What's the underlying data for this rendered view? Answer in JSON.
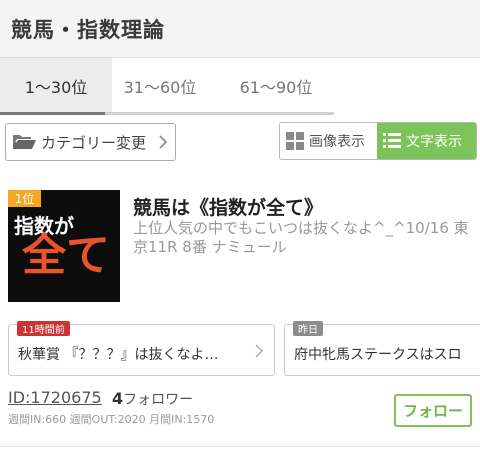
{
  "header": {
    "title": "競馬・指数理論"
  },
  "tabs": [
    {
      "label": "1〜30位"
    },
    {
      "label": "31〜60位"
    },
    {
      "label": "61〜90位"
    }
  ],
  "toolbar": {
    "category_label": "カテゴリー変更",
    "view_image_label": "画像表示",
    "view_text_label": "文字表示"
  },
  "ranking": {
    "rank_badge": "1位",
    "thumb_line1": "指数が",
    "thumb_line2": "全て",
    "title": "競馬は《指数が全て》",
    "description": "上位人気の中でもこいつは抜くなよ^_^10/16 東京11R 8番 ナミュール",
    "cards": [
      {
        "badge": "11時間前",
        "text": "秋華賞 『？？？』は抜くなよ…"
      },
      {
        "badge": "昨日",
        "text": "府中牝馬ステークスはスロ"
      }
    ],
    "blog_id": "ID:1720675",
    "follower_count": "4",
    "follower_label": "フォロワー",
    "stats": "週間IN:660  週間OUT:2020  月間IN:1570",
    "follow_button": "フォロー"
  },
  "colors": {
    "accent_green": "#7cc45a",
    "rank_badge": "#f5a623",
    "time_badge_red": "#cc3333",
    "thumb_text_orange": "#e8542c"
  }
}
